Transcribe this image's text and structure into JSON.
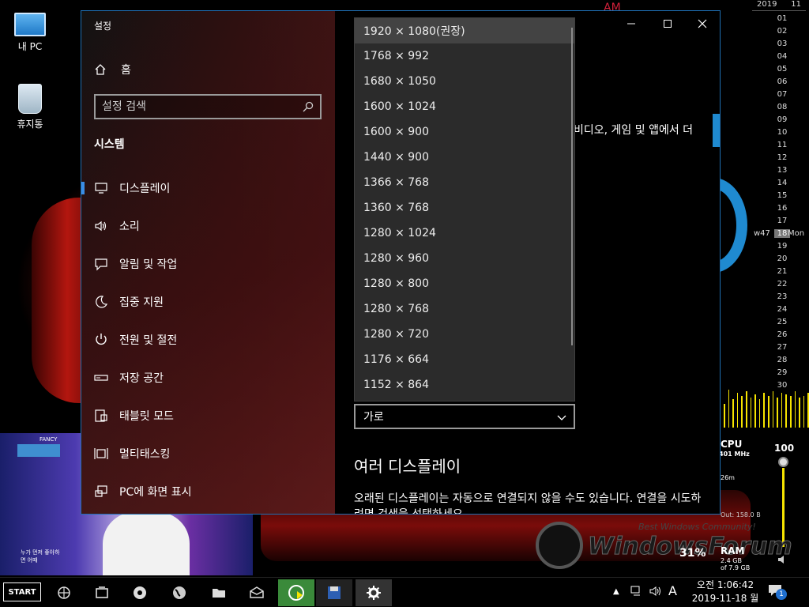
{
  "desktop": {
    "icons": [
      {
        "label": "내 PC"
      },
      {
        "label": "휴지통"
      }
    ],
    "am_label": "AM"
  },
  "calendar": {
    "year": "2019",
    "month": "11",
    "days": [
      "01",
      "02",
      "03",
      "04",
      "05",
      "06",
      "07",
      "08",
      "09",
      "10",
      "11",
      "12",
      "13",
      "14",
      "15",
      "16",
      "17",
      "18",
      "19",
      "20",
      "21",
      "22",
      "23",
      "24",
      "25",
      "26",
      "27",
      "28",
      "29",
      "30"
    ],
    "today": "18",
    "week": "w47",
    "weekday": "Mon"
  },
  "gadget": {
    "cpu_label": "CPU",
    "cpu_freq": "401 MHz",
    "uptime": "26m",
    "net_out": "Out: 158.0 B",
    "cpu_percent": "31%",
    "ram_label": "RAM",
    "ram_used": "2.4 GB",
    "ram_total": "of 7.9 GB",
    "volume_value": "100",
    "volume_level": 1.0,
    "watermark_tagline": "Best Windows Community!",
    "watermark_text": "WindowsForum"
  },
  "tv": {
    "logo_text": "FANCY",
    "caption": "누가 먼저 좋아하면 어때"
  },
  "settings": {
    "window_title": "설정",
    "home_label": "홈",
    "search_placeholder": "설정 검색",
    "section_title": "시스템",
    "nav": [
      {
        "label": "디스플레이",
        "icon": "monitor-icon",
        "active": true
      },
      {
        "label": "소리",
        "icon": "speaker-icon"
      },
      {
        "label": "알림 및 작업",
        "icon": "message-icon"
      },
      {
        "label": "집중 지원",
        "icon": "moon-icon"
      },
      {
        "label": "전원 및 절전",
        "icon": "power-icon"
      },
      {
        "label": "저장 공간",
        "icon": "storage-icon"
      },
      {
        "label": "태블릿 모드",
        "icon": "tablet-icon"
      },
      {
        "label": "멀티태스킹",
        "icon": "multitask-icon"
      },
      {
        "label": "PC에 화면 표시",
        "icon": "project-icon"
      }
    ],
    "resolution_options": [
      "1920 × 1080(권장)",
      "1768 × 992",
      "1680 × 1050",
      "1600 × 1024",
      "1600 × 900",
      "1440 × 900",
      "1366 × 768",
      "1360 × 768",
      "1280 × 1024",
      "1280 × 960",
      "1280 × 800",
      "1280 × 768",
      "1280 × 720",
      "1176 × 664",
      "1152 × 864"
    ],
    "selected_resolution": "1920 × 1080(권장)",
    "partial_text": "비디오, 게임 및 앱에서 더",
    "orientation_value": "가로",
    "multi_display_heading": "여러 디스플레이",
    "multi_display_text": "오래된 디스플레이는 자동으로 연결되지 않을 수도 있습니다. 연결을 시도하려면 검색을 선택하세요."
  },
  "taskbar": {
    "start_label": "START",
    "tray_ime": "A",
    "notification_count": "1",
    "time": "오전 1:06:42",
    "date": "2019-11-18 월"
  },
  "colors": {
    "accent_blue": "#1f6fb3",
    "active_indicator": "#3a8ee6",
    "yellow": "#f6e400"
  }
}
